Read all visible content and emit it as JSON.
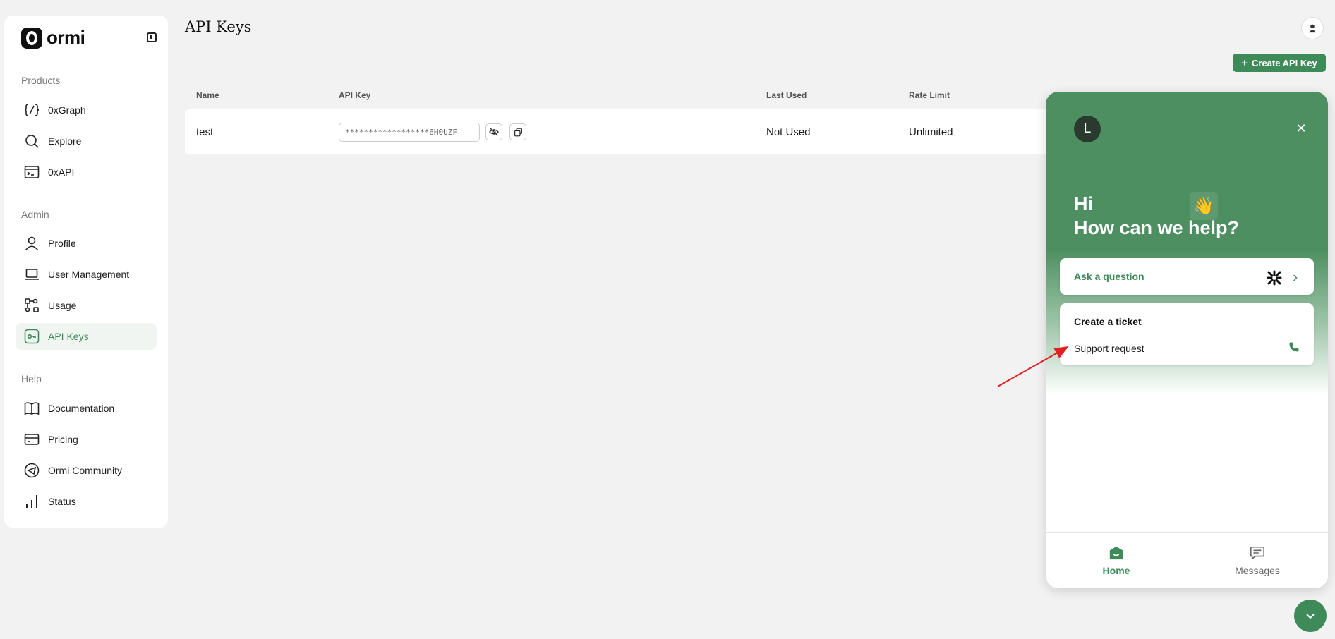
{
  "brand": {
    "name": "ormi"
  },
  "sidebar": {
    "sections": [
      {
        "label": "Products"
      },
      {
        "label": "Admin"
      },
      {
        "label": "Help"
      }
    ],
    "items": [
      {
        "label": "0xGraph",
        "icon": "braces-slash-icon"
      },
      {
        "label": "Explore",
        "icon": "search-icon"
      },
      {
        "label": "0xAPI",
        "icon": "terminal-icon"
      },
      {
        "label": "Profile",
        "icon": "user-icon"
      },
      {
        "label": "User Management",
        "icon": "laptop-icon"
      },
      {
        "label": "Usage",
        "icon": "usage-icon"
      },
      {
        "label": "API Keys",
        "icon": "key-icon",
        "active": true
      },
      {
        "label": "Documentation",
        "icon": "book-icon"
      },
      {
        "label": "Pricing",
        "icon": "credit-card-icon"
      },
      {
        "label": "Ormi Community",
        "icon": "telegram-icon"
      },
      {
        "label": "Status",
        "icon": "bar-chart-icon"
      }
    ]
  },
  "header": {
    "title": "API Keys",
    "create_button": "Create API Key"
  },
  "table": {
    "columns": [
      "Name",
      "API Key",
      "Last Used",
      "Rate Limit"
    ],
    "rows": [
      {
        "name": "test",
        "api_key": "******************6H0UZF",
        "last_used": "Not Used",
        "rate_limit": "Unlimited"
      }
    ]
  },
  "support_widget": {
    "avatar_letter": "L",
    "greeting_line1": "Hi",
    "greeting_line2": "How can we help?",
    "wave_emoji": "👋",
    "ask_question": "Ask a question",
    "ticket_title": "Create a ticket",
    "ticket_item": "Support request",
    "tabs": [
      "Home",
      "Messages"
    ]
  },
  "colors": {
    "accent": "#3f8a59",
    "widget_header": "#4d8f60",
    "annotation_arrow": "#e02020"
  }
}
